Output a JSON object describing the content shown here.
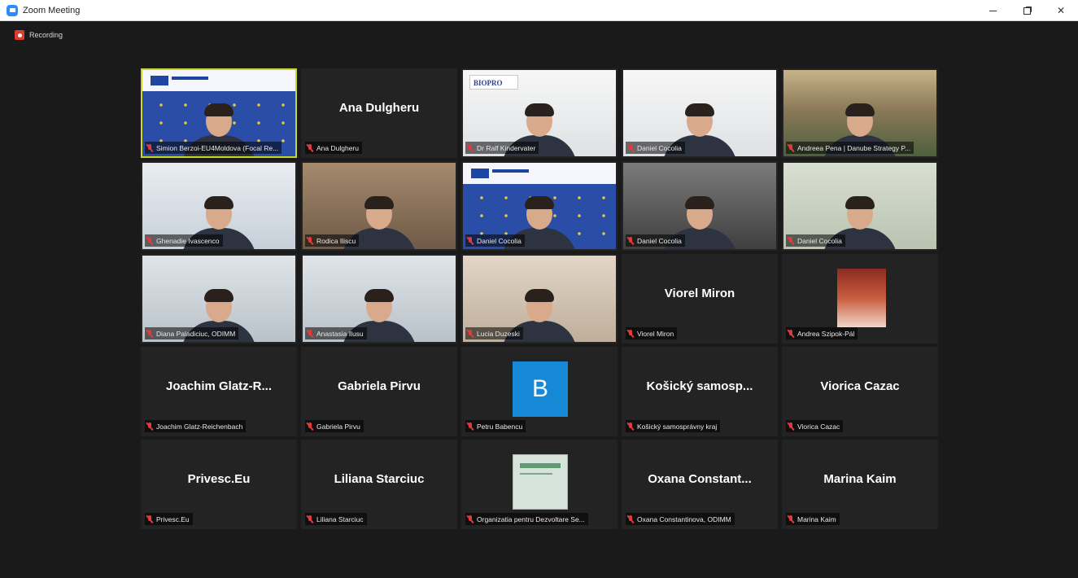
{
  "window": {
    "title": "Zoom Meeting"
  },
  "window_controls": {
    "minimize": "—",
    "maximize": "",
    "close": "✕"
  },
  "meeting": {
    "recording_label": "Recording"
  },
  "tiles": [
    {
      "label": "Simion Berzoi-EU4Moldova (Focal Re...",
      "display": "",
      "video": "eu",
      "active": true
    },
    {
      "label": "Ana Dulgheru",
      "display": "Ana Dulgheru"
    },
    {
      "label": "Dr Ralf Kindervater",
      "display": "",
      "video": "white",
      "logo": "BIOPRO"
    },
    {
      "label": "Daniel Cocolia",
      "display": "",
      "video": "white"
    },
    {
      "label": "Andreea Pena | Danube Strategy P...",
      "display": "",
      "video": "landscape"
    },
    {
      "label": "Ghenadie Ivascenco",
      "display": "",
      "video": "light"
    },
    {
      "label": "Rodica Iliscu",
      "display": "",
      "video": "room"
    },
    {
      "label": "Daniel Cocolia",
      "display": "",
      "video": "eu"
    },
    {
      "label": "Daniel Cocolia",
      "display": "",
      "video": "dark"
    },
    {
      "label": "Daniel Cocolia",
      "display": "",
      "video": "green"
    },
    {
      "label": "Diana Paladiciuc, ODIMM",
      "display": "",
      "video": "office"
    },
    {
      "label": "Anastasia Ilusu",
      "display": "",
      "video": "office"
    },
    {
      "label": "Lucia Duzeski",
      "display": "",
      "video": "warm"
    },
    {
      "label": "Viorel Miron",
      "display": "Viorel Miron"
    },
    {
      "label": "Andrea Szipok-Pál",
      "display": "",
      "avatar": "photo"
    },
    {
      "label": "Joachim Glatz-Reichenbach",
      "display": "Joachim  Glatz-R..."
    },
    {
      "label": "Gabriela Pirvu",
      "display": "Gabriela Pirvu"
    },
    {
      "label": "Petru Babencu",
      "display": "",
      "avatar": "B"
    },
    {
      "label": "Košický samosprávny kraj",
      "display": "Košický  samosp..."
    },
    {
      "label": "Viorica Cazac",
      "display": "Viorica Cazac"
    },
    {
      "label": "Privesc.Eu",
      "display": "Privesc.Eu"
    },
    {
      "label": "Liliana Starciuc",
      "display": "Liliana Starciuc"
    },
    {
      "label": "Organizatia pentru Dezvoltare Se...",
      "display": "",
      "avatar": "logo"
    },
    {
      "label": "Oxana Constantinova, ODIMM",
      "display": "Oxana  Constant..."
    },
    {
      "label": "Marina Kaim",
      "display": "Marina Kaim"
    }
  ]
}
